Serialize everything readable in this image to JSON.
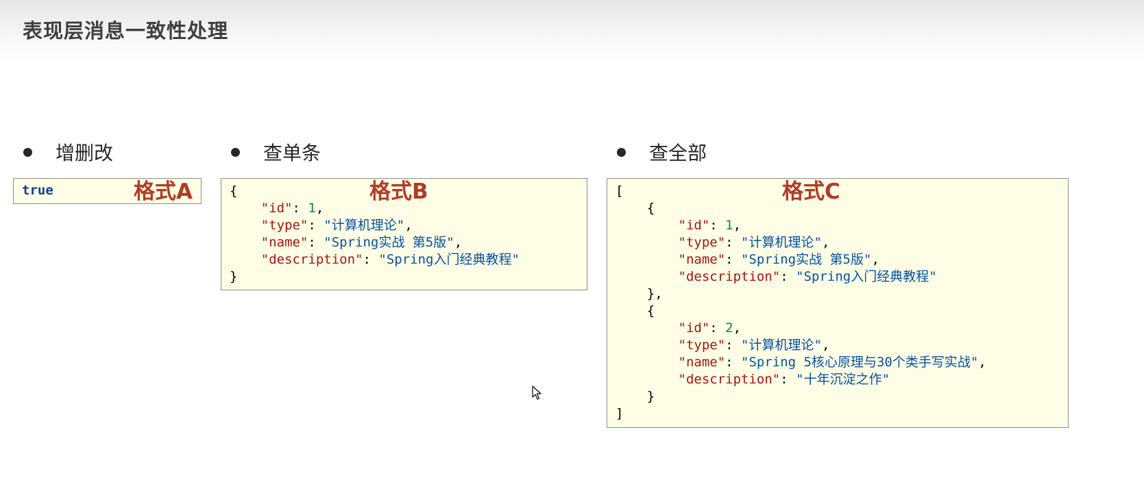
{
  "title": "表现层消息一致性处理",
  "sections": [
    {
      "label": "增删改",
      "format": "格式A",
      "code": "true"
    },
    {
      "label": "查单条",
      "format": "格式B"
    },
    {
      "label": "查全部",
      "format": "格式C"
    }
  ],
  "book1": {
    "id": "1",
    "type": "\"计算机理论\"",
    "name": "\"Spring实战 第5版\"",
    "description": "\"Spring入门经典教程\""
  },
  "book2": {
    "id": "2",
    "type": "\"计算机理论\"",
    "name": "\"Spring 5核心原理与30个类手写实战\"",
    "description": "\"十年沉淀之作\""
  },
  "keys": {
    "id": "\"id\"",
    "type": "\"type\"",
    "name": "\"name\"",
    "description": "\"description\""
  }
}
